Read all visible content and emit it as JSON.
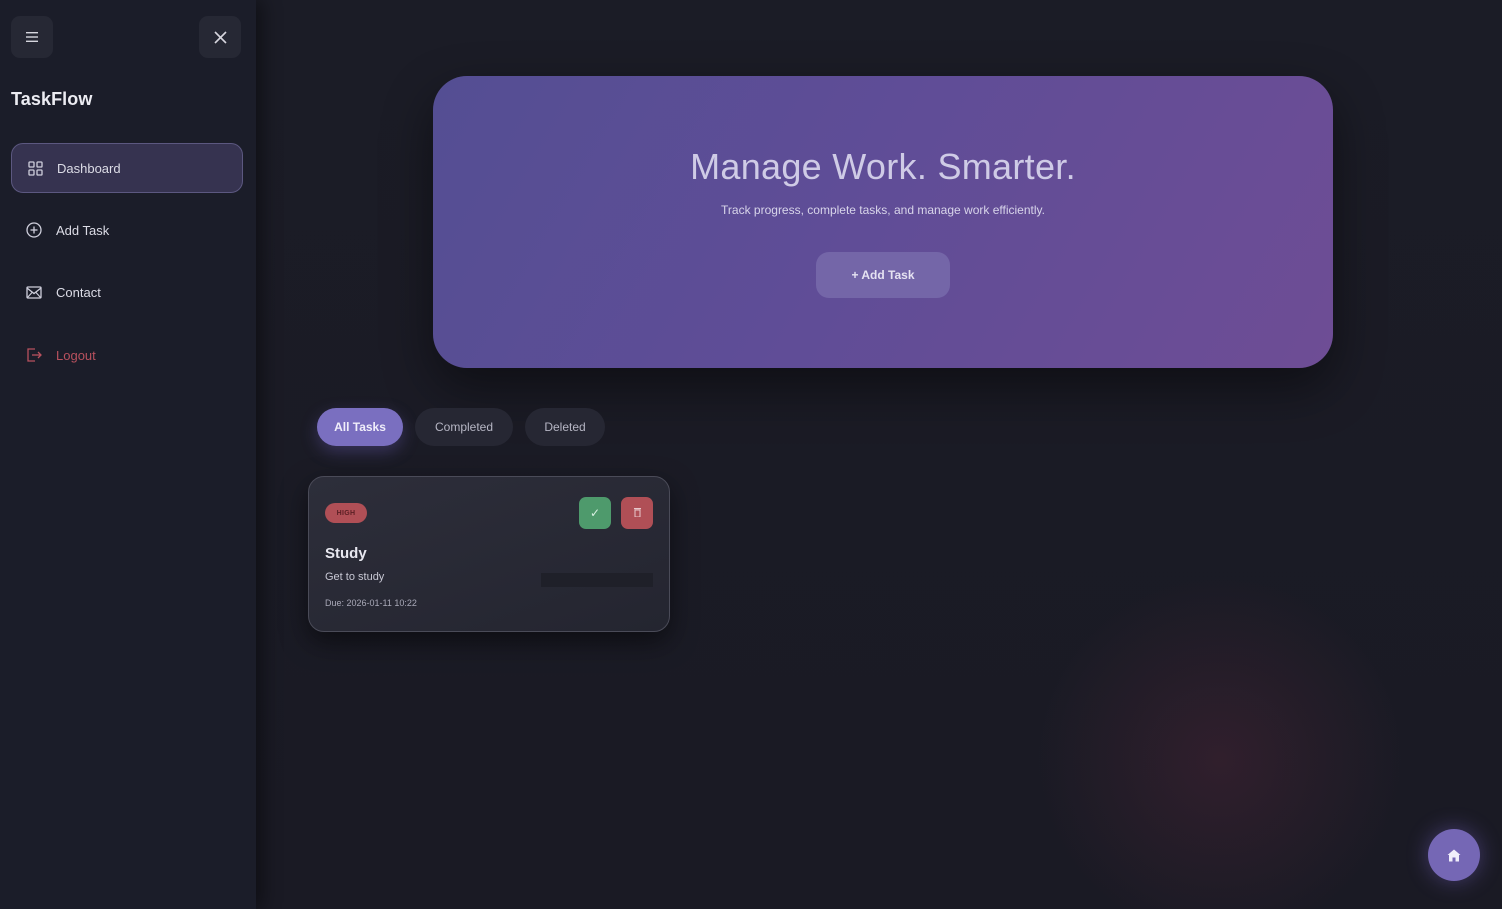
{
  "sidebar": {
    "menu_icon": "hamburger-icon",
    "close_icon": "close-icon",
    "brand": "TaskFlow",
    "items": [
      {
        "label": "Dashboard",
        "icon": "grid-icon",
        "active": true
      },
      {
        "label": "Add Task",
        "icon": "plus-circle-icon"
      },
      {
        "label": "Contact",
        "icon": "mail-icon"
      },
      {
        "label": "Logout",
        "icon": "logout-icon",
        "color": "#b8515e"
      }
    ]
  },
  "hero": {
    "title": "Manage Work. Smarter.",
    "subtitle": "Track progress, complete tasks, and manage work efficiently.",
    "button": "+ Add Task"
  },
  "filters": {
    "tabs": [
      "All Tasks",
      "Completed",
      "Deleted"
    ],
    "active": "All Tasks"
  },
  "tasks": [
    {
      "priority": "HIGH",
      "title": "Study",
      "description": "Get to study",
      "due": "Due: 2026-01-11 10:22",
      "complete_icon": "check-icon",
      "delete_icon": "trash-icon"
    }
  ],
  "fab": {
    "icon": "home-icon"
  },
  "colors": {
    "accent": "#7a6fc0",
    "success": "#4e9a6c",
    "danger": "#b04f56",
    "background": "#1a1b25"
  }
}
